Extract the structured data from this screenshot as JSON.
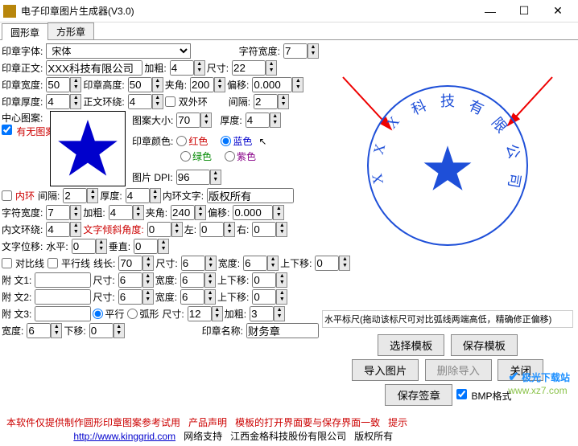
{
  "window": {
    "title": "电子印章图片生成器(V3.0)"
  },
  "tabs": {
    "round": "圆形章",
    "square": "方形章"
  },
  "font": {
    "label": "印章字体:",
    "value": "宋体",
    "widthLabel": "字符宽度:",
    "width": "7"
  },
  "text": {
    "label": "印章正文:",
    "value": "XXX科技有限公司",
    "boldLabel": "加粗:",
    "bold": "4",
    "sizeLabel": "尺寸:",
    "size": "22"
  },
  "stampW": {
    "label": "印章宽度:",
    "value": "50",
    "heightLabel": "印章高度:",
    "height": "50",
    "angleLabel": "夹角:",
    "angle": "200",
    "offsetLabel": "偏移:",
    "offset": "0.000"
  },
  "thick": {
    "label": "印章厚度:",
    "value": "4",
    "aroundLabel": "正文环绕:",
    "around": "4",
    "doubleLabel": "双外环",
    "gapLabel": "间隔:",
    "gap": "2"
  },
  "center": {
    "label": "中心图案:",
    "hasNone": "有无图案",
    "patternSizeLabel": "图案大小:",
    "patternSize": "70",
    "thickLabel": "厚度:",
    "thickVal": "4"
  },
  "color": {
    "label": "印章颜色:",
    "red": "红色",
    "blue": "蓝色",
    "green": "绿色",
    "purple": "紫色",
    "selected": "blue"
  },
  "dpi": {
    "label": "图片 DPI:",
    "value": "96"
  },
  "inner": {
    "ringLabel": "内环",
    "gapLabel": "间隔:",
    "gap": "2",
    "thickLabel": "厚度:",
    "thick": "4",
    "textLabel": "内环文字:",
    "text": "版权所有"
  },
  "charW": {
    "label": "字符宽度:",
    "value": "7",
    "boldLabel": "加粗:",
    "bold": "4",
    "angleLabel": "夹角:",
    "angle": "240",
    "offsetLabel": "偏移:",
    "offset": "0.000"
  },
  "innerAround": {
    "label": "内文环绕:",
    "value": "4",
    "tiltLabel": "文字倾斜角度:",
    "tilt": "0",
    "leftLabel": "左:",
    "left": "0",
    "rightLabel": "右:",
    "right": "0"
  },
  "textPos": {
    "label": "文字位移:",
    "hLabel": "水平:",
    "h": "0",
    "vLabel": "垂直:",
    "v": "0"
  },
  "contrast": {
    "label": "对比线",
    "parallelLabel": "平行线",
    "lenLabel": "线长:",
    "len": "70",
    "sizeLabel": "尺寸:",
    "size": "6",
    "widthLabel": "宽度:",
    "width": "6",
    "udLabel": "上下移:",
    "ud": "0"
  },
  "attach1": {
    "label": "附  文1:",
    "value": "",
    "sizeLabel": "尺寸:",
    "size": "6",
    "widthLabel": "宽度:",
    "width": "6",
    "udLabel": "上下移:",
    "ud": "0"
  },
  "attach2": {
    "label": "附  文2:",
    "value": "",
    "sizeLabel": "尺寸:",
    "size": "6",
    "widthLabel": "宽度:",
    "width": "6",
    "udLabel": "上下移:",
    "ud": "0"
  },
  "attach3": {
    "label": "附  文3:",
    "value": "",
    "parallelLabel": "平行",
    "arcLabel": "弧形",
    "sizeLabel": "尺寸:",
    "size": "12",
    "boldLabel": "加粗:",
    "bold": "3"
  },
  "wide": {
    "label": "宽度:",
    "value": "6",
    "udLabel": "下移:",
    "ud": "0",
    "nameLabel": "印章名称:",
    "name": "财务章"
  },
  "ruler": "水平标尺(拖动该标尺可对比弧线两端高低，精确修正偏移)",
  "buttons": {
    "selectTpl": "选择模板",
    "saveTpl": "保存模板",
    "importImg": "导入图片",
    "deleteImport": "删除导入",
    "close": "关闭",
    "saveSign": "保存签章",
    "bmpFormat": "BMP格式"
  },
  "footer": {
    "line1a": "本软件仅提供制作圆形印章图案参考试用",
    "line1b": "产品声明",
    "line1c": "模板的打开界面要与保存界面一致",
    "line1d": "提示",
    "url": "http://www.kinggrid.com",
    "netSupport": "网络支持",
    "company": "江西金格科技股份有限公司",
    "copyright": "版权所有"
  },
  "brand": {
    "name": "极光下载站",
    "url": "www.xz7.com"
  },
  "sealText": [
    "X",
    "X",
    "X",
    "科",
    "技",
    "有",
    "限",
    "公",
    "司"
  ]
}
